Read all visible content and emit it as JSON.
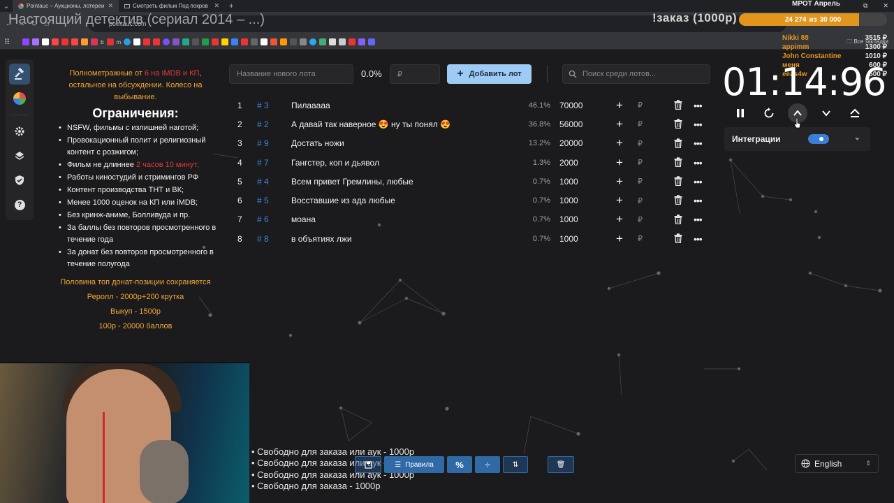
{
  "browser": {
    "tabs": [
      {
        "title": "Pointauc – Аукционы, лотереи",
        "active": true
      },
      {
        "title": "Смотреть фильм Под покров",
        "active": false
      },
      {
        "title": "",
        "active": false
      }
    ],
    "url": "pointauc.com",
    "bookmark_labels": [
      "b",
      "m"
    ],
    "bookmarks_folder": "Все закладки"
  },
  "stream_overlay": {
    "page_title": "Настоящий детектив (сериал 2014 – ...)",
    "order_banner": "!заказ (1000р)",
    "goal_title": "МРОТ Апрель",
    "goal_current": "24 274",
    "goal_sep": "из",
    "goal_target": "30 000",
    "goal_progress": 0.809,
    "donors": [
      {
        "name": "Nikki 88",
        "amount": "3515 ₽"
      },
      {
        "name": "appimm",
        "amount": "1300 ₽"
      },
      {
        "name": "John Constantine",
        "amount": "1010 ₽"
      },
      {
        "name": "меня",
        "amount": "600 ₽"
      },
      {
        "name": "eeas4w",
        "amount": "500 ₽"
      }
    ]
  },
  "sidebar": {
    "items": [
      {
        "icon": "gavel-icon",
        "active": true
      },
      {
        "icon": "pie-wheel-icon",
        "active": false
      },
      {
        "icon": "gear-icon",
        "active": false
      },
      {
        "icon": "layers-icon",
        "active": false
      },
      {
        "icon": "shield-icon",
        "active": false
      },
      {
        "icon": "help-icon",
        "active": false
      }
    ]
  },
  "rules": {
    "intro_1": "Полнометражные от ",
    "intro_red": "6 на IMDB и КП",
    "intro_2": ", остальное на обсуждении. Колесо на выбывание.",
    "heading": "Ограничения:",
    "items": [
      "NSFW, фильмы с излишней наготой;",
      "Провокационный полит и религиозный контент с розжигом;",
      "Фильм не длиннее ",
      "Работы киностудий и стримингов РФ",
      "Контент производства ТНТ и ВК;",
      "Менее 1000 оценок на КП или iMDB;",
      "Без кринж-аниме, Болливуда и пр.",
      "За баллы без повторов просмотренного в течение года",
      "За донат без повторов просмотренного в течение полугода"
    ],
    "item3_red": "2 часов 10 минут;",
    "footer": [
      "Половина топ донат-позиции сохраняется",
      "Реролл - 2000р+200 крутка",
      "Выкуп - 1500р",
      "100р - 20000 баллов"
    ]
  },
  "controls": {
    "lot_name_placeholder": "Название нового лота",
    "percent": "0.0%",
    "amount_placeholder": "₽",
    "add_button": "Добавить лот",
    "search_placeholder": "Поиск среди лотов..."
  },
  "lots": [
    {
      "index": "1",
      "id": "# 3",
      "name": "Пилааааа",
      "share": "46.1%",
      "amount": "70000"
    },
    {
      "index": "2",
      "id": "# 2",
      "name": "А давай так наверное 😍 ну ты понял 😍",
      "share": "36.8%",
      "amount": "56000"
    },
    {
      "index": "3",
      "id": "# 9",
      "name": "Достать ножи",
      "share": "13.2%",
      "amount": "20000"
    },
    {
      "index": "4",
      "id": "# 7",
      "name": "Гангстер, коп и дьявол",
      "share": "1.3%",
      "amount": "2000"
    },
    {
      "index": "5",
      "id": "# 4",
      "name": "Всем привет Гремлины, любые",
      "share": "0.7%",
      "amount": "1000"
    },
    {
      "index": "6",
      "id": "# 5",
      "name": "Восставшие из ада  любые",
      "share": "0.7%",
      "amount": "1000"
    },
    {
      "index": "7",
      "id": "# 6",
      "name": "моана",
      "share": "0.7%",
      "amount": "1000"
    },
    {
      "index": "8",
      "id": "# 8",
      "name": "в объятиях лжи",
      "share": "0.7%",
      "amount": "1000"
    }
  ],
  "lot_currency": "₽",
  "timer": {
    "value": "01:14:96",
    "integrations_label": "Интеграции",
    "integrations_enabled": true
  },
  "ticker": [
    "• Свободно для заказа или аук - 1000р",
    "• Свободно для заказа или аук - 1000р",
    "• Свободно для заказа или аук - 1000р",
    "• Свободно для заказа - 1000р"
  ],
  "bottom_toolbar": {
    "rules_label": "Правила"
  },
  "language": {
    "selected": "English"
  },
  "colors": {
    "accent": "#9ecbf5",
    "id_blue": "#3c87d6",
    "orange": "#f3a633",
    "red": "#e03b3b",
    "goal_fill": "#e2951d"
  }
}
